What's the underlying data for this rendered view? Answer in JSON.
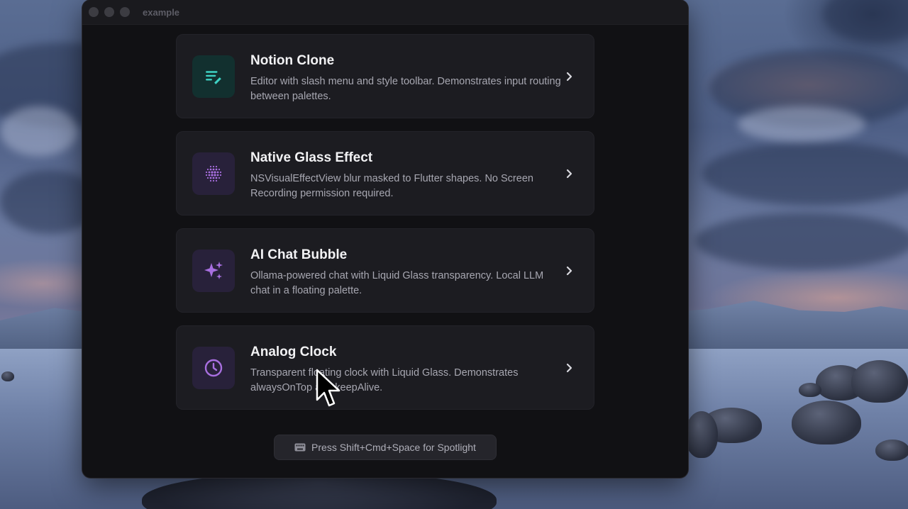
{
  "window": {
    "title": "example"
  },
  "cards": [
    {
      "title": "Notion Clone",
      "description": "Editor with slash menu and style toolbar. Demonstrates input routing between palettes.",
      "icon": "notes-edit-icon",
      "icon_color": "#3ed2c4",
      "icon_bg": "#12302f"
    },
    {
      "title": "Native Glass Effect",
      "description": "NSVisualEffectView blur masked to Flutter shapes. No Screen Recording permission required.",
      "icon": "dot-grid-icon",
      "icon_color": "#a86fe0",
      "icon_bg": "#28213a"
    },
    {
      "title": "AI Chat Bubble",
      "description": "Ollama-powered chat with Liquid Glass transparency. Local LLM chat in a floating palette.",
      "icon": "sparkles-icon",
      "icon_color": "#a86fe0",
      "icon_bg": "#28213a"
    },
    {
      "title": "Analog Clock",
      "description": "Transparent floating clock with Liquid Glass. Demonstrates alwaysOnTop and keepAlive.",
      "icon": "clock-icon",
      "icon_color": "#a86fe0",
      "icon_bg": "#28213a"
    }
  ],
  "footer": {
    "hint": "Press Shift+Cmd+Space for Spotlight",
    "icon": "keyboard-icon"
  }
}
